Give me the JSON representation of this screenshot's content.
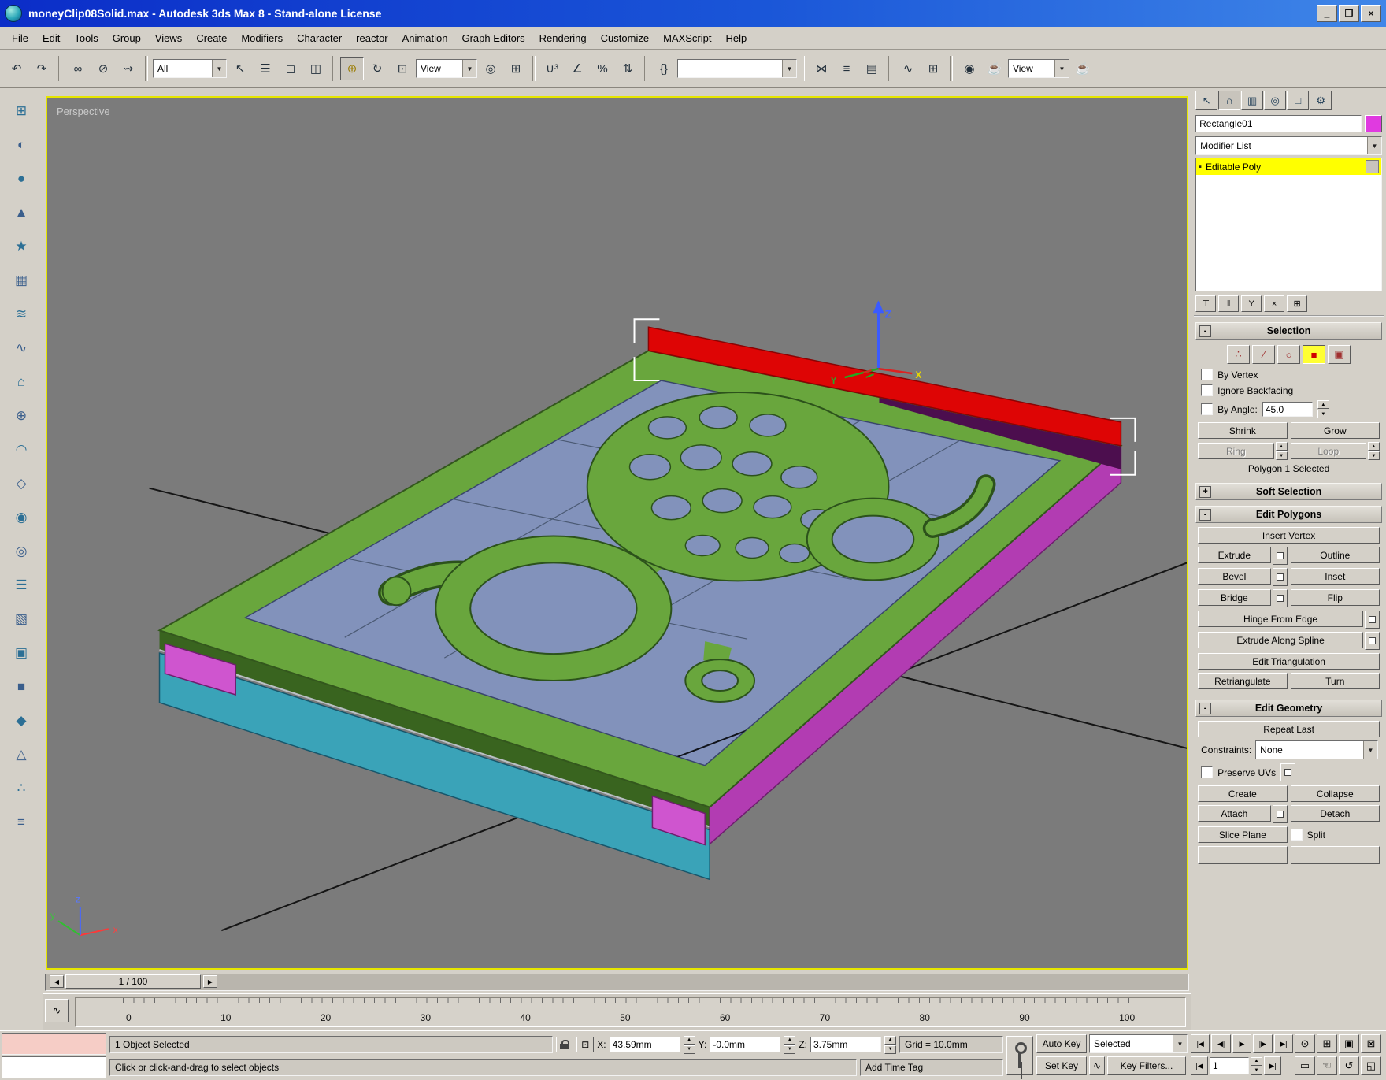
{
  "titlebar": {
    "title": "moneyClip08Solid.max - Autodesk 3ds Max 8  - Stand-alone License"
  },
  "menu": {
    "items": [
      "File",
      "Edit",
      "Tools",
      "Group",
      "Views",
      "Create",
      "Modifiers",
      "Character",
      "reactor",
      "Animation",
      "Graph Editors",
      "Rendering",
      "Customize",
      "MAXScript",
      "Help"
    ]
  },
  "toolbar": {
    "selection_filter": "All",
    "coord_system": "View",
    "render_type": "View",
    "named_selection": ""
  },
  "icons": {
    "minimize": "_",
    "restore": "❐",
    "close": "×",
    "undo": "↶",
    "redo": "↷",
    "link": "∞",
    "unlink": "⊘",
    "bind_spacewarp": "⇝",
    "select": "↖",
    "select_by_name": "☰",
    "region_rect": "◻",
    "window_crossing": "◫",
    "move": "⊕",
    "rotate": "↻",
    "scale": "⊡",
    "pivot_center": "◎",
    "manipulate": "⊞",
    "snap_3d": "∪³",
    "snap_angle": "∠",
    "snap_percent": "%",
    "snap_spinner": "⇅",
    "named_sets": "{}",
    "mirror": "⋈",
    "align": "≡",
    "layers": "▤",
    "curve_editor": "∿",
    "schematic_view": "⊞",
    "material_editor": "◉",
    "render_setup": "☕",
    "quick_render": "☕",
    "arrow_down": "▼",
    "arrow_up": "▲",
    "arrow_left": "◀",
    "arrow_right": "▶",
    "tab_create": "↖",
    "tab_modify": "∩",
    "tab_hierarchy": "▥",
    "tab_motion": "◎",
    "tab_display": "□",
    "tab_utilities": "⚙",
    "stack_bullet": "▪",
    "pin_stack": "⊤",
    "show_end_result": "‖",
    "make_unique": "Y",
    "remove_modifier": "×",
    "configure_sets": "⊞",
    "so_vertex": "∴",
    "so_edge": "∕",
    "so_border": "○",
    "so_polygon": "■",
    "so_element": "▣",
    "abs_offset": "⊡",
    "time_curve": "∿",
    "goto_start": "|◀",
    "prev_frame": "◀|",
    "play": "▶",
    "next_frame": "|▶",
    "goto_end": "▶|",
    "zoom": "⊙",
    "zoom_all": "⊞",
    "zoom_extents": "▣",
    "zoom_extents_all": "⊠",
    "zoom_region": "▭",
    "pan": "☜",
    "arc_rotate": "↺",
    "min_max_toggle": "◱",
    "expand": "+",
    "collapse": "-",
    "left": [
      "⊞",
      "◐",
      "●",
      "▲",
      "★",
      "▦",
      "≋",
      "∿",
      "⌂",
      "⊕",
      "◠",
      "◇",
      "◉",
      "◎",
      "☰",
      "▧",
      "▣",
      "■",
      "◆",
      "△",
      "∴",
      "≡"
    ]
  },
  "viewport": {
    "label": "Perspective",
    "world_x": "x",
    "world_y": "y",
    "world_z": "z",
    "gizmo_x": "X",
    "gizmo_y": "Y",
    "gizmo_z": "Z"
  },
  "command_panel": {
    "object_name": "Rectangle01",
    "modifier_list": "Modifier List",
    "stack_item": "Editable Poly",
    "selection": {
      "title": "Selection",
      "by_vertex": "By Vertex",
      "ignore_backfacing": "Ignore Backfacing",
      "by_angle_label": "By Angle:",
      "by_angle_value": "45.0",
      "shrink": "Shrink",
      "grow": "Grow",
      "ring": "Ring",
      "loop": "Loop",
      "status": "Polygon 1 Selected"
    },
    "soft_selection": {
      "title": "Soft Selection"
    },
    "edit_polygons": {
      "title": "Edit Polygons",
      "insert_vertex": "Insert Vertex",
      "extrude": "Extrude",
      "outline": "Outline",
      "bevel": "Bevel",
      "inset": "Inset",
      "bridge": "Bridge",
      "flip": "Flip",
      "hinge": "Hinge From Edge",
      "extrude_spline": "Extrude Along Spline",
      "edit_tri": "Edit Triangulation",
      "retriangulate": "Retriangulate",
      "turn": "Turn"
    },
    "edit_geometry": {
      "title": "Edit Geometry",
      "repeat_last": "Repeat Last",
      "constraints_label": "Constraints:",
      "constraints_value": "None",
      "preserve_uvs": "Preserve UVs",
      "create": "Create",
      "collapse": "Collapse",
      "attach": "Attach",
      "detach": "Detach",
      "slice_plane": "Slice Plane",
      "split": "Split"
    }
  },
  "timeline": {
    "frame_display": "1 / 100",
    "ticks": [
      "0",
      "10",
      "20",
      "30",
      "40",
      "50",
      "60",
      "70",
      "80",
      "90",
      "100"
    ]
  },
  "statusbar": {
    "selection_status": "1 Object Selected",
    "x_label": "X:",
    "x_value": "43.59mm",
    "y_label": "Y:",
    "y_value": "-0.0mm",
    "z_label": "Z:",
    "z_value": "3.75mm",
    "grid": "Grid = 10.0mm",
    "prompt": "Click or click-and-drag to select objects",
    "add_time_tag": "Add Time Tag",
    "auto_key": "Auto Key",
    "set_key": "Set Key",
    "selected_filter": "Selected",
    "key_filters": "Key Filters...",
    "frame": "1"
  },
  "colors": {
    "object_swatch": "#e03ae0",
    "stack_highlight": "#ffff00",
    "selected_face": "#dd0505",
    "top_face": "#69a63d",
    "side_face": "#b23cb2",
    "bottom_face": "#3aa3b8"
  }
}
